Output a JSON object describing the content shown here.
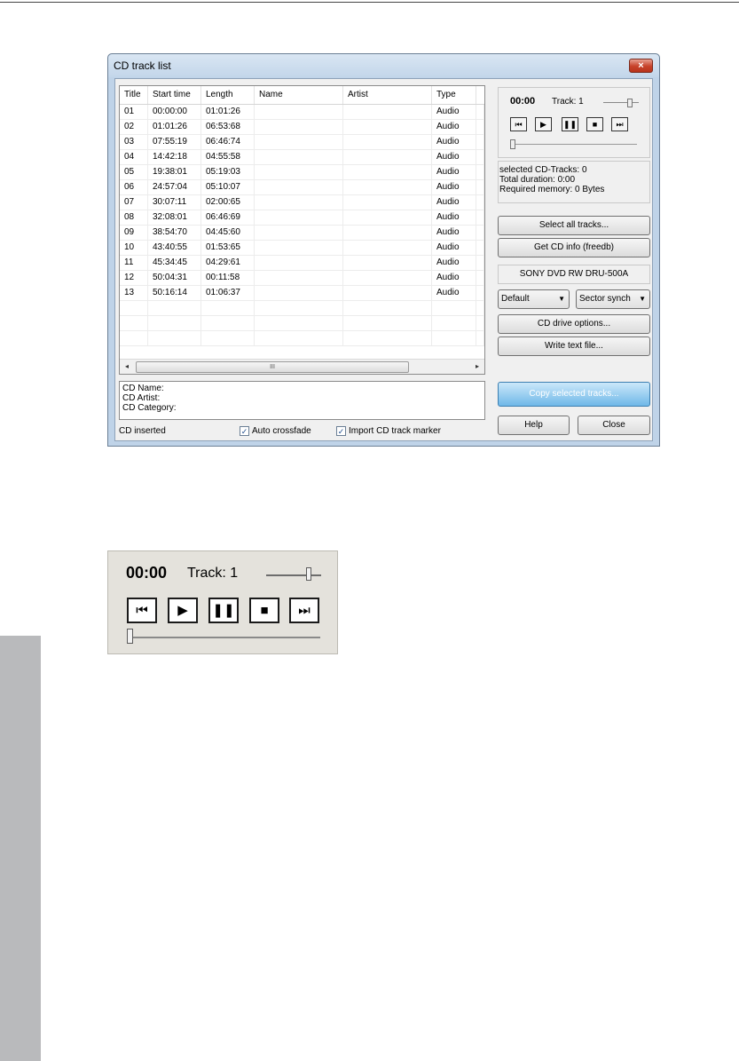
{
  "dialog": {
    "title": "CD track list",
    "close_icon": "×"
  },
  "tracklist": {
    "columns": [
      "Title",
      "Start time",
      "Length",
      "Name",
      "Artist",
      "Type"
    ],
    "rows": [
      {
        "title": "01",
        "start": "00:00:00",
        "length": "01:01:26",
        "name": "",
        "artist": "",
        "type": "Audio"
      },
      {
        "title": "02",
        "start": "01:01:26",
        "length": "06:53:68",
        "name": "",
        "artist": "",
        "type": "Audio"
      },
      {
        "title": "03",
        "start": "07:55:19",
        "length": "06:46:74",
        "name": "",
        "artist": "",
        "type": "Audio"
      },
      {
        "title": "04",
        "start": "14:42:18",
        "length": "04:55:58",
        "name": "",
        "artist": "",
        "type": "Audio"
      },
      {
        "title": "05",
        "start": "19:38:01",
        "length": "05:19:03",
        "name": "",
        "artist": "",
        "type": "Audio"
      },
      {
        "title": "06",
        "start": "24:57:04",
        "length": "05:10:07",
        "name": "",
        "artist": "",
        "type": "Audio"
      },
      {
        "title": "07",
        "start": "30:07:11",
        "length": "02:00:65",
        "name": "",
        "artist": "",
        "type": "Audio"
      },
      {
        "title": "08",
        "start": "32:08:01",
        "length": "06:46:69",
        "name": "",
        "artist": "",
        "type": "Audio"
      },
      {
        "title": "09",
        "start": "38:54:70",
        "length": "04:45:60",
        "name": "",
        "artist": "",
        "type": "Audio"
      },
      {
        "title": "10",
        "start": "43:40:55",
        "length": "01:53:65",
        "name": "",
        "artist": "",
        "type": "Audio"
      },
      {
        "title": "11",
        "start": "45:34:45",
        "length": "04:29:61",
        "name": "",
        "artist": "",
        "type": "Audio"
      },
      {
        "title": "12",
        "start": "50:04:31",
        "length": "00:11:58",
        "name": "",
        "artist": "",
        "type": "Audio"
      },
      {
        "title": "13",
        "start": "50:16:14",
        "length": "01:06:37",
        "name": "",
        "artist": "",
        "type": "Audio"
      }
    ],
    "scroll_left_icon": "◂",
    "scroll_right_icon": "▸",
    "scroll_thumb_grip": "III"
  },
  "cdinfo": {
    "name_label": "CD Name:",
    "artist_label": "CD Artist:",
    "category_label": "CD Category:"
  },
  "footer": {
    "status": "CD inserted",
    "auto_crossfade": "Auto crossfade",
    "import_marker": "Import CD track marker",
    "check_mark": "✓"
  },
  "player": {
    "time": "00:00",
    "track": "Track: 1",
    "volume_level": 0.8,
    "position_level": 0.0,
    "icons": [
      "skip-back-icon",
      "play-icon",
      "pause-icon",
      "stop-icon",
      "skip-forward-icon"
    ],
    "glyphs": [
      "⏮",
      "▶",
      "❚❚",
      "■",
      "⏭"
    ]
  },
  "stats": {
    "selected": "selected CD-Tracks: 0",
    "duration": "Total duration:  0:00",
    "memory": "Required memory: 0 Bytes"
  },
  "buttons": {
    "select_all": "Select all tracks...",
    "get_info": "Get CD info (freedb)",
    "drive_options": "CD drive options...",
    "write_text": "Write text file...",
    "copy_selected": "Copy selected tracks...",
    "help": "Help",
    "close": "Close"
  },
  "drive": {
    "name": "SONY    DVD RW DRU-500A",
    "speed": "Default",
    "sync": "Sector synch",
    "dropdown_glyph": "▼"
  },
  "zoom_player": {
    "time": "00:00",
    "track": "Track: 1"
  }
}
